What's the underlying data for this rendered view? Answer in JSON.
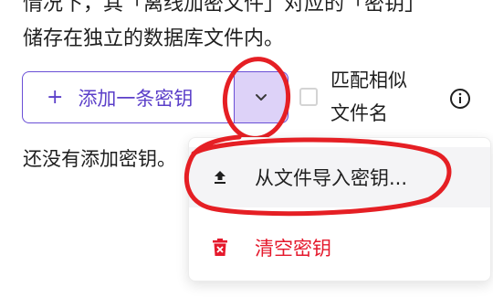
{
  "intro": {
    "line1": "情况下，其「离线加密文件」对应的「密钥」",
    "line2": "储存在独立的数据库文件内。"
  },
  "toolbar": {
    "add_plus": "+",
    "add_label": "添加一条密钥",
    "similar_label_line1": "匹配相似",
    "similar_label_line2": "文件名"
  },
  "empty_state": {
    "text": "还没有添加密钥。"
  },
  "menu": {
    "import_label": "从文件导入密钥...",
    "clear_label": "清空密钥"
  },
  "colors": {
    "accent": "#5b3fc9",
    "danger": "#e5192c",
    "annotation": "#e51f24"
  },
  "icons": {
    "dropdown": "chevron-down-icon",
    "info": "info-icon",
    "import": "upload-icon",
    "clear": "trash-icon"
  }
}
